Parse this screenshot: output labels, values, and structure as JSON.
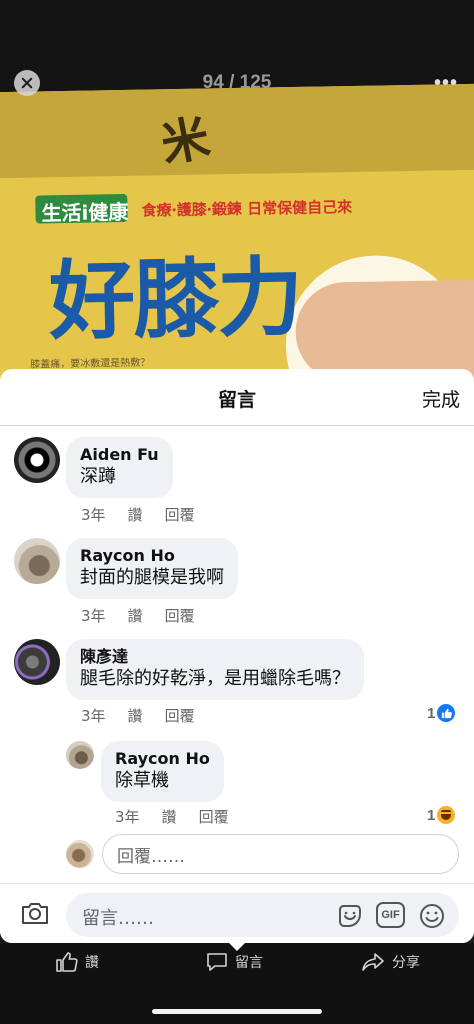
{
  "viewer": {
    "counter": "94 / 125",
    "more_label": "•••"
  },
  "photo": {
    "brand": "生活i健康",
    "tagline": "食療‧護膝‧鍛鍊 日常保健自己來",
    "title": "好膝力",
    "subtitle": "膝蓋痛，要冰敷還是熱敷？",
    "calligraphy": "米"
  },
  "sheet": {
    "title": "留言",
    "done_label": "完成"
  },
  "comments": [
    {
      "name": "Aiden Fu",
      "text": "深蹲",
      "time": "3年",
      "like": "讚",
      "reply": "回覆"
    },
    {
      "name": "Raycon Ho",
      "text": "封面的腿模是我啊",
      "time": "3年",
      "like": "讚",
      "reply": "回覆"
    },
    {
      "name": "陳彥達",
      "text": "腿毛除的好乾淨，是用蠟除毛嗎？",
      "time": "3年",
      "like": "讚",
      "reply": "回覆",
      "reaction_count": "1",
      "reaction": "like"
    },
    {
      "name": "Raycon Ho",
      "text": "除草機",
      "time": "3年",
      "like": "讚",
      "reply": "回覆",
      "reaction_count": "1",
      "reaction": "haha"
    }
  ],
  "reply_placeholder": "回覆……",
  "composer": {
    "placeholder": "留言……",
    "icons": [
      "camera-icon",
      "sticker-icon",
      "gif-icon",
      "emoji-icon"
    ],
    "gif_label": "GIF"
  },
  "bottom_bar": {
    "like_label": "讚",
    "comment_label": "留言",
    "share_label": "分享"
  },
  "colors": {
    "like_blue": "#1877f2",
    "haha_yellow": "#f7b125",
    "bubble_gray": "#eff1f4"
  }
}
